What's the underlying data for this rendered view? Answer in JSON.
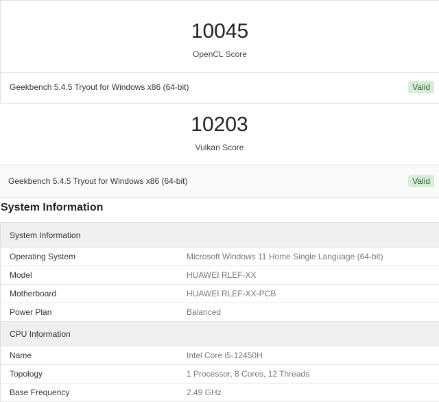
{
  "scores": [
    {
      "value": "10045",
      "label": "OpenCL Score",
      "version": "Geekbench 5.4.5 Tryout for Windows x86 (64-bit)",
      "status": "Valid"
    },
    {
      "value": "10203",
      "label": "Vulkan Score",
      "version": "Geekbench 5.4.5 Tryout for Windows x86 (64-bit)",
      "status": "Valid"
    }
  ],
  "system_information": {
    "title": "System Information",
    "groups": [
      {
        "header": "System Information",
        "rows": [
          {
            "key": "Operating System",
            "value": "Microsoft Windows 11 Home Single Language (64-bit)"
          },
          {
            "key": "Model",
            "value": "HUAWEI RLEF-XX"
          },
          {
            "key": "Motherboard",
            "value": "HUAWEI RLEF-XX-PCB"
          },
          {
            "key": "Power Plan",
            "value": "Balanced"
          }
        ]
      },
      {
        "header": "CPU Information",
        "rows": [
          {
            "key": "Name",
            "value": "Intel Core i5-12450H"
          },
          {
            "key": "Topology",
            "value": "1 Processor, 8 Cores, 12 Threads"
          },
          {
            "key": "Base Frequency",
            "value": "2.49 GHz"
          }
        ]
      }
    ]
  },
  "colors": {
    "valid_badge_bg": "#d9ecd9",
    "valid_badge_text": "#2e6b2e",
    "group_header_bg": "#f0f0f0"
  }
}
